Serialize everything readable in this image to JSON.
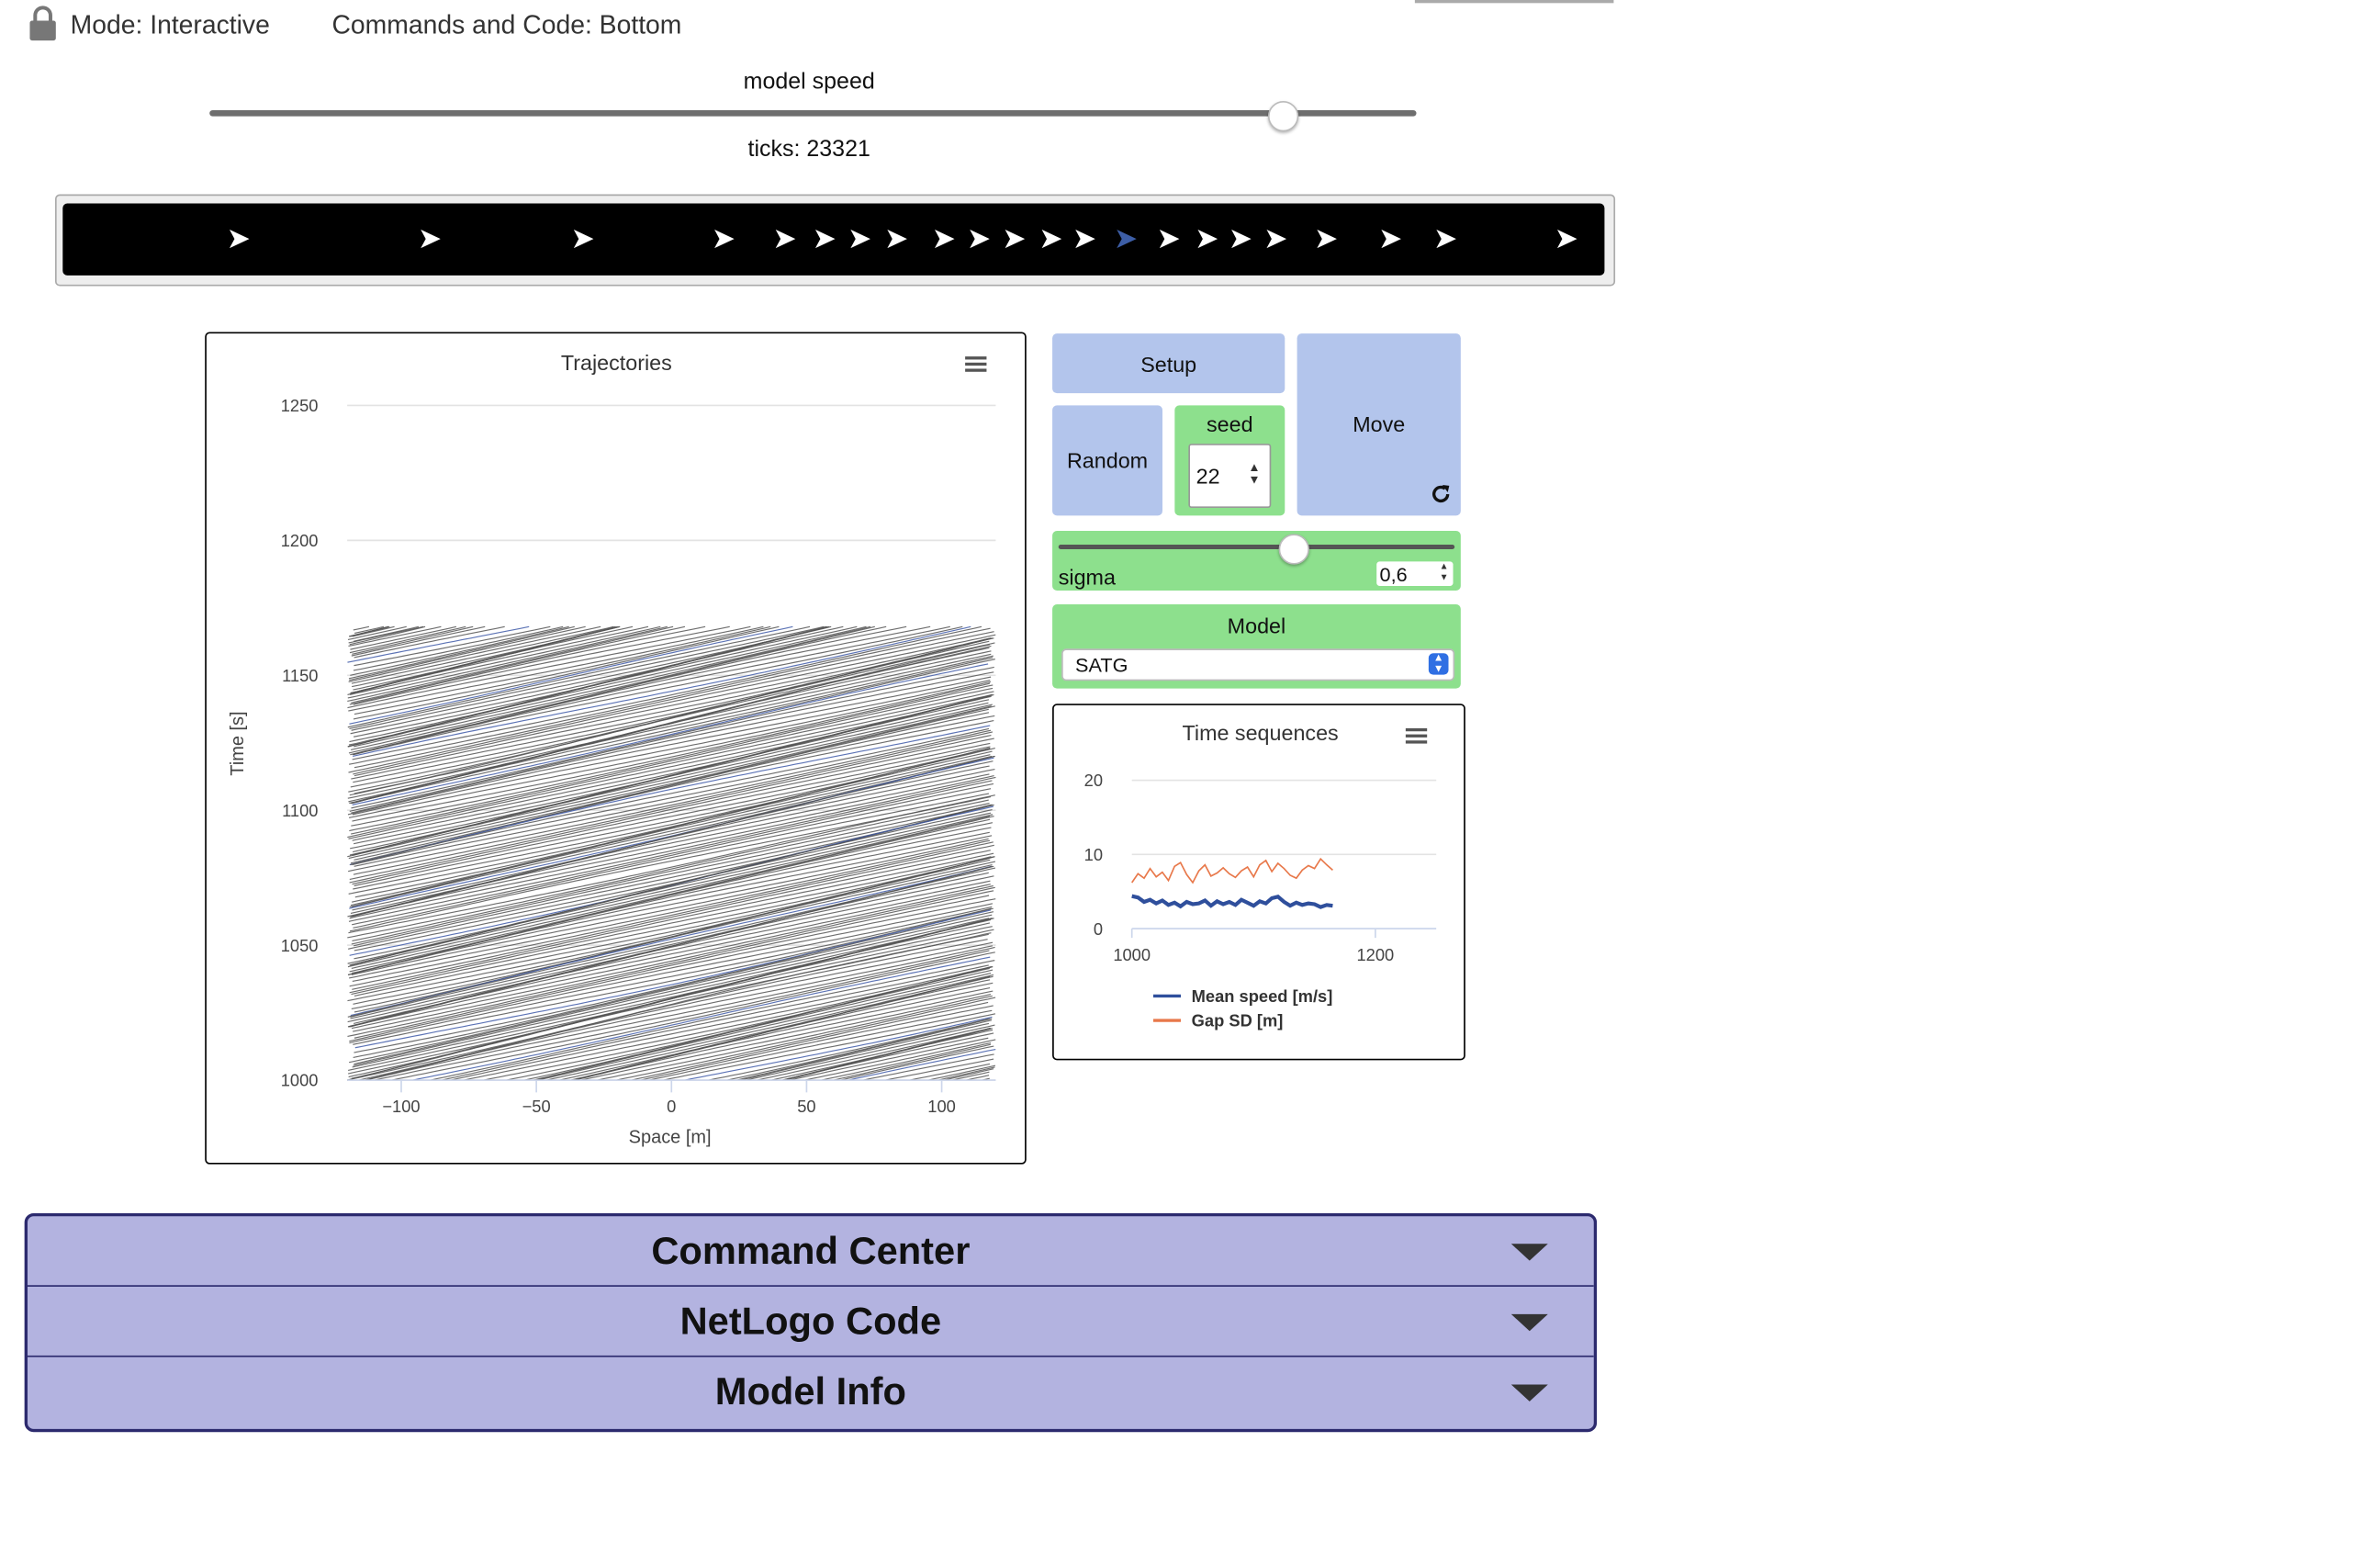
{
  "topbar": {
    "mode_label": "Mode: Interactive",
    "commands_label": "Commands and Code: Bottom"
  },
  "speed": {
    "label": "model speed",
    "ticks_label": "ticks: 23321",
    "value_fraction": 0.89
  },
  "view": {
    "turtle_glyph": "➤"
  },
  "buttons": {
    "setup": "Setup",
    "random": "Random",
    "move": "Move",
    "forever_icon": "refresh-icon"
  },
  "seed": {
    "label": "seed",
    "value": "22"
  },
  "sigma": {
    "label": "sigma",
    "value": "0,6",
    "value_fraction": 0.59
  },
  "model": {
    "label": "Model",
    "selected": "SATG"
  },
  "accordion": {
    "command_center": "Command Center",
    "netlogo_code": "NetLogo Code",
    "model_info": "Model Info"
  },
  "colors": {
    "button_blue": "#b3c5ec",
    "widget_green": "#8de08d",
    "accordion_bg": "#b3b3e0",
    "accordion_border": "#2c2a6e",
    "trajectory_gray": "#555555",
    "trajectory_blue": "#3f5aa8",
    "speed_series": "#2f4f9c",
    "gap_series": "#e8784a"
  },
  "chart_data": [
    {
      "type": "line",
      "title": "Trajectories",
      "xlabel": "Space [m]",
      "ylabel": "Time [s]",
      "xlim": [
        -120,
        120
      ],
      "ylim": [
        1000,
        1250
      ],
      "xticks": [
        "−100",
        "−50",
        "0",
        "50",
        "100"
      ],
      "xtick_values": [
        -100,
        -50,
        0,
        50,
        100
      ],
      "yticks": [
        "1000",
        "1050",
        "1100",
        "1150",
        "1200",
        "1250"
      ],
      "ytick_values": [
        1000,
        1050,
        1100,
        1150,
        1200,
        1250
      ],
      "series_description_count": 60,
      "time_range": [
        1000,
        1168
      ],
      "vehicle_speed_approx": 4.5,
      "vehicles": 60,
      "road_length": 240
    },
    {
      "type": "line",
      "title": "Time sequences",
      "xlim": [
        1000,
        1250
      ],
      "ylim": [
        0,
        20
      ],
      "xticks": [
        "1000",
        "1200"
      ],
      "xtick_values": [
        1000,
        1200
      ],
      "yticks": [
        "0",
        "10",
        "20"
      ],
      "ytick_values": [
        0,
        10,
        20
      ],
      "x": [
        1000,
        1005,
        1010,
        1015,
        1020,
        1025,
        1030,
        1035,
        1040,
        1045,
        1050,
        1055,
        1060,
        1065,
        1070,
        1075,
        1080,
        1085,
        1090,
        1095,
        1100,
        1105,
        1110,
        1115,
        1120,
        1125,
        1130,
        1135,
        1140,
        1145,
        1150,
        1155,
        1160,
        1165
      ],
      "series": [
        {
          "name": "Mean speed [m/s]",
          "values": [
            4.4,
            4.2,
            3.6,
            3.9,
            3.4,
            3.8,
            3.2,
            3.5,
            3.0,
            3.6,
            3.3,
            3.4,
            3.8,
            3.1,
            3.7,
            3.3,
            3.6,
            3.2,
            3.9,
            3.5,
            3.1,
            3.7,
            3.4,
            4.1,
            4.3,
            3.6,
            3.1,
            3.5,
            3.2,
            3.4,
            3.3,
            2.9,
            3.2,
            3.1
          ]
        },
        {
          "name": "Gap SD [m]",
          "values": [
            6.2,
            7.4,
            6.8,
            8.1,
            7.0,
            7.6,
            6.5,
            8.4,
            8.9,
            7.3,
            6.2,
            7.8,
            8.6,
            7.1,
            7.5,
            8.2,
            7.4,
            6.9,
            7.8,
            8.3,
            7.0,
            8.6,
            9.2,
            7.7,
            8.8,
            8.1,
            7.2,
            6.8,
            7.9,
            8.5,
            8.1,
            9.4,
            8.6,
            7.9
          ]
        }
      ]
    }
  ]
}
